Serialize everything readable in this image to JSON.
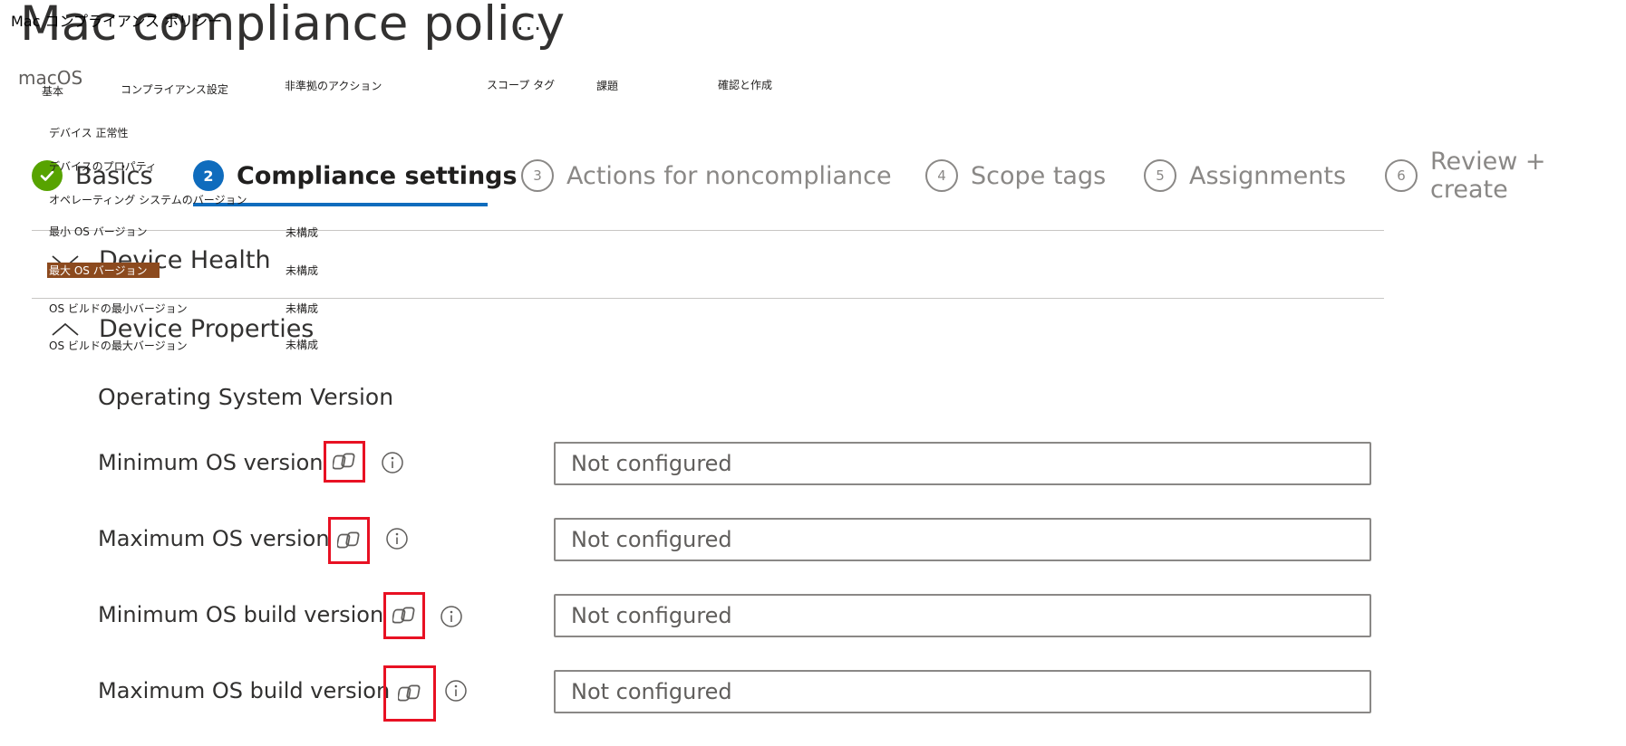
{
  "header": {
    "title": "Mac compliance policy",
    "more": "···",
    "subtitle": "macOS"
  },
  "wizard": {
    "steps": [
      {
        "number": "✓",
        "label": "Basics",
        "state": "done"
      },
      {
        "number": "2",
        "label": "Compliance settings",
        "state": "active"
      },
      {
        "number": "3",
        "label": "Actions for noncompliance",
        "state": "todo"
      },
      {
        "number": "4",
        "label": "Scope tags",
        "state": "todo"
      },
      {
        "number": "5",
        "label": "Assignments",
        "state": "todo"
      },
      {
        "number": "6",
        "label": "Review + create",
        "state": "todo"
      }
    ]
  },
  "sections": {
    "device_health": {
      "title": "Device Health",
      "expanded": false
    },
    "device_properties": {
      "title": "Device Properties",
      "expanded": true
    }
  },
  "os_group": {
    "title": "Operating System Version",
    "rows": [
      {
        "label": "Minimum OS version",
        "value": "Not configured"
      },
      {
        "label": "Maximum OS version",
        "value": "Not configured"
      },
      {
        "label": "Minimum OS build version",
        "value": "Not configured"
      },
      {
        "label": "Maximum OS build version",
        "value": "Not configured"
      }
    ]
  },
  "jp_overlay": {
    "title": "Mac コンプライアンス ポリシー",
    "tabs": [
      "基本",
      "コンプライアンス設定",
      "非準拠のアクション",
      "スコープ タグ",
      "課題",
      "確認と作成"
    ],
    "device_health": "デバイス 正常性",
    "device_properties": "デバイスのプロパティ",
    "os_version": "オペレーティング システムのバージョン",
    "rows": [
      {
        "label": "最小 OS バージョン",
        "value": "未構成"
      },
      {
        "label": "最大 OS バージョン",
        "value": "未構成"
      },
      {
        "label": "OS ビルドの最小バージョン",
        "value": "未構成"
      },
      {
        "label": "OS ビルドの最大バージョン",
        "value": "未構成"
      }
    ]
  },
  "colors": {
    "accent": "#0f6cbd",
    "success": "#57a300",
    "highlight_box": "#e81123",
    "annotation_highlight": "#8c4a1e"
  }
}
